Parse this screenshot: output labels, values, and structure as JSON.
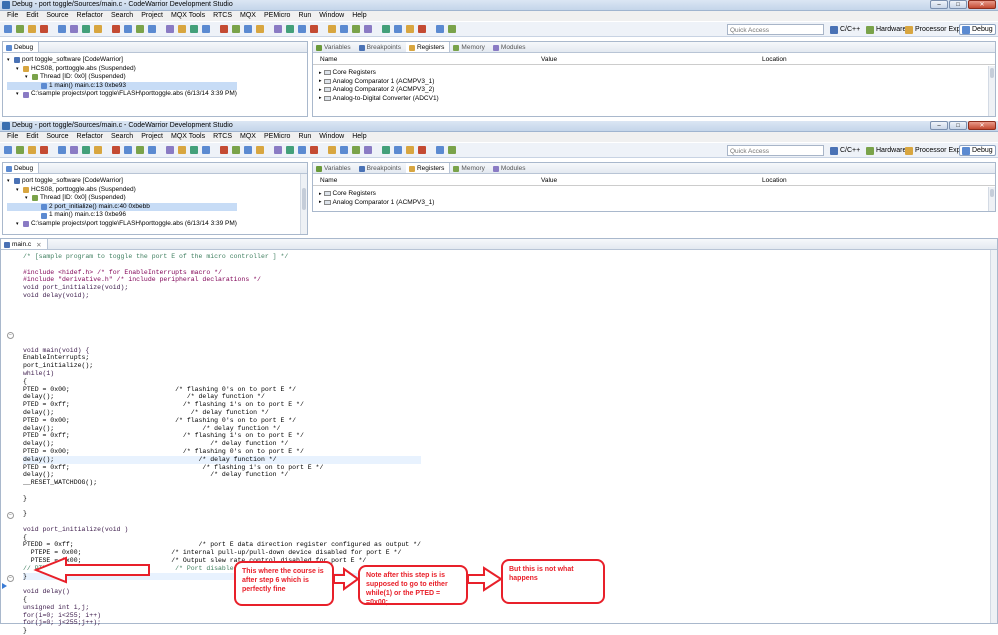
{
  "windows": [
    {
      "title": "Debug - port toggle/Sources/main.c - CodeWarrior Development Studio",
      "debug_tree": [
        {
          "label": "port toggle_software [CodeWarrior]",
          "indent": 0,
          "icon": "c-project-icon",
          "selected": false
        },
        {
          "label": "HCS08, porttoggle.abs (Suspended)",
          "indent": 1,
          "icon": "target-icon",
          "selected": false
        },
        {
          "label": "Thread [ID: 0x0] (Suspended)",
          "indent": 2,
          "icon": "thread-icon",
          "selected": false
        },
        {
          "label": "1 main() main.c:13 0xbe93",
          "indent": 3,
          "icon": "stack-frame-icon",
          "selected": true
        },
        {
          "label": "C:\\sample projects\\port toggle\\FLASH\\porttoggle.abs (6/13/14 3:39 PM)",
          "indent": 1,
          "icon": "process-icon",
          "selected": false
        }
      ],
      "registers": [
        "Core Registers",
        "Analog Comparator 1 (ACMPV3_1)",
        "Analog Comparator 2 (ACMPV3_2)",
        "Analog-to-Digital Converter (ADCV1)"
      ]
    },
    {
      "title": "Debug - port toggle/Sources/main.c - CodeWarrior Development Studio",
      "debug_tree": [
        {
          "label": "port toggle_software [CodeWarrior]",
          "indent": 0,
          "icon": "c-project-icon",
          "selected": false
        },
        {
          "label": "HCS08, porttoggle.abs (Suspended)",
          "indent": 1,
          "icon": "target-icon",
          "selected": false
        },
        {
          "label": "Thread [ID: 0x0] (Suspended)",
          "indent": 2,
          "icon": "thread-icon",
          "selected": false
        },
        {
          "label": "2 port_initialize() main.c:40 0xbebb",
          "indent": 3,
          "icon": "stack-frame-icon",
          "selected": true
        },
        {
          "label": "1 main() main.c:13 0xbe96",
          "indent": 3,
          "icon": "stack-frame-icon",
          "selected": false
        },
        {
          "label": "C:\\sample projects\\port toggle\\FLASH\\porttoggle.abs (6/13/14 3:39 PM)",
          "indent": 1,
          "icon": "process-icon",
          "selected": false
        }
      ],
      "registers": [
        "Core Registers",
        "Analog Comparator 1 (ACMPV3_1)"
      ]
    }
  ],
  "menu": [
    "File",
    "Edit",
    "Source",
    "Refactor",
    "Search",
    "Project",
    "MQX Tools",
    "RTCS",
    "MQX",
    "PEMicro",
    "Run",
    "Window",
    "Help"
  ],
  "quick_access": "Quick Access",
  "perspectives": [
    "C/C++",
    "Hardware",
    "Processor Expert",
    "Debug"
  ],
  "debug_view_tab": "Debug",
  "right_tabs": [
    "Variables",
    "Breakpoints",
    "Registers",
    "Memory",
    "Modules"
  ],
  "register_columns": [
    "Name",
    "Value",
    "Location"
  ],
  "editor_tab": "main.c",
  "code_lines": [
    "/* [sample program to toggle the port E of the micro controller ] */",
    "",
    "#include <hidef.h> /* for EnableInterrupts macro */",
    "#include \"derivative.h\" /* include peripheral declarations */",
    "void port_initialize(void);",
    "void delay(void);",
    "",
    "",
    "",
    "",
    "",
    "",
    "void main(void) {",
    "EnableInterrupts;",
    "port_initialize();",
    "while(1)",
    "{",
    "PTED = 0x00;                           /* flashing 0's on to port E */",
    "delay();                                  /* delay function */",
    "PTED = 0xff;                             /* flashing 1's on to port E */",
    "delay();                                   /* delay function */",
    "PTED = 0x00;                           /* flashing 0's on to port E */",
    "delay();                                      /* delay function */",
    "PTED = 0xff;                             /* flashing 1's on to port E */",
    "delay();                                        /* delay function */",
    "PTED = 0x00;                             /* flashing 0's on to port E */",
    "delay();                                     /* delay function */",
    "PTED = 0xff;                                  /* flashing 1's on to port E */",
    "delay();                                        /* delay function */",
    "__RESET_WATCHDOG();",
    "",
    "}",
    "",
    "}",
    "",
    "void port_initialize(void )",
    "{",
    "PTEDD = 0xff;                                /* port E data direction register configured as output */",
    "  PTEPE = 0x00;                       /* internal pull-up/pull-down device disabled for port E */",
    "  PTESE = 0x00;                       /* Output slew rate control disabled for port E */",
    "// PTEPE = 0x00;                       /* Port disabled as interrupt */",
    "}",
    "",
    "void delay()",
    "{",
    "unsigned int i,j;",
    "for(i=0; i<255; i++)",
    "for(j=0; j<255;j++);",
    "}"
  ],
  "annotations": {
    "note1": "This where the course is after step 6 which is perfectly fine",
    "note2": "Note after this step is is supposed to go to either while(1) or the PTED = =0x00;",
    "note3": "But this is not what happens"
  },
  "colors": {
    "annotation": "#e8202a",
    "keyword": "#7f0055",
    "comment": "#3f7f5f",
    "string": "#2a00ff"
  }
}
